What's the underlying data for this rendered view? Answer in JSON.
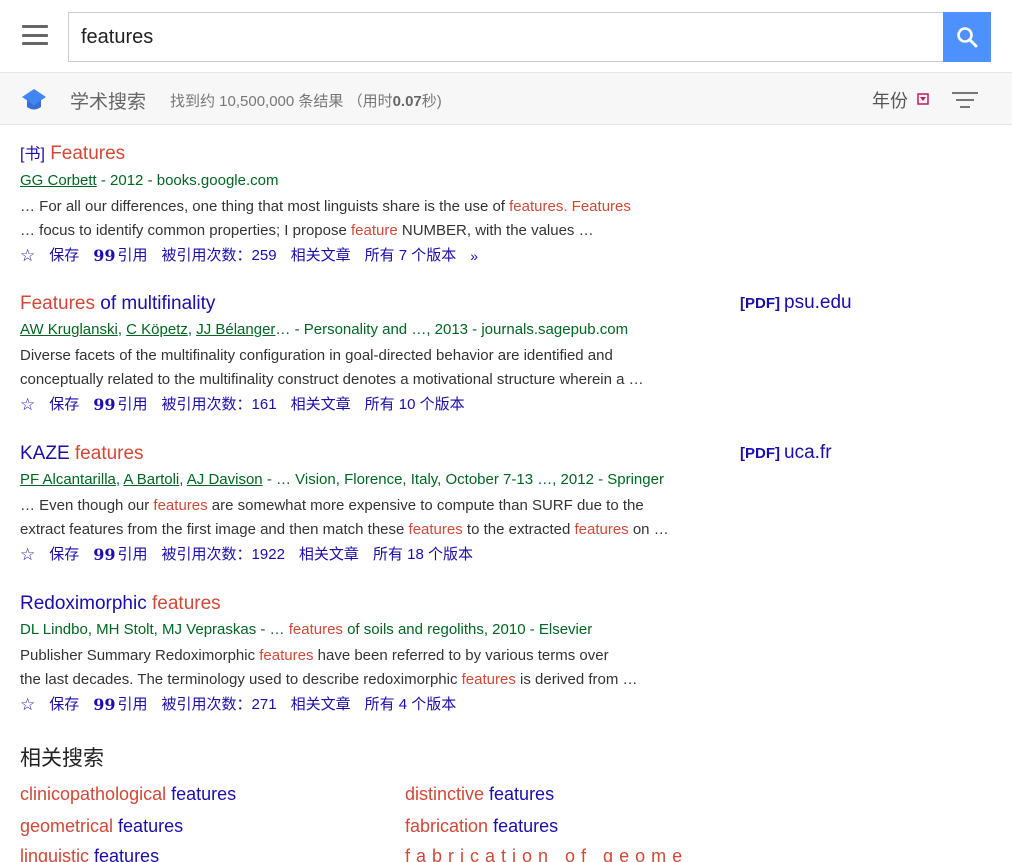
{
  "search": {
    "query": "features"
  },
  "subbar": {
    "scholar_label": "学术搜索",
    "stats_prefix": "找到约 10,500,000 条结果 （用时",
    "stats_time": "0.07",
    "stats_suffix": "秒)",
    "year_label": "年份"
  },
  "actions": {
    "save": "保存",
    "cite": "引用",
    "related": "相关文章"
  },
  "results": [
    {
      "tag": "[书]",
      "title_hl": "Features",
      "title_rest": "",
      "authors": [
        "GG Corbett"
      ],
      "source": " - 2012 - books.google.com",
      "snippet": [
        {
          "t": "… For all our differences, one thing that most linguists share is the use of ",
          "h": false
        },
        {
          "t": "features. Features",
          "h": true
        }
      ],
      "cited": "被引用次数：259",
      "versions": "所有 7 个版本"
    },
    {
      "tag": "",
      "title_hl": "Features",
      "title_rest": " of multifinality",
      "authors": [
        "AW Kruglanski",
        "C Köpetz",
        "JJ Bélanger"
      ],
      "source": "… - Personality and …, 2013 - journals.sagepub.com",
      "snippet": [
        {
          "t": "Diverse facets of the multifinality configuration in goal-directed behavior are identified and",
          "h": false
        }
      ],
      "cited": "被引用次数：161",
      "versions": "所有 10 个版本",
      "pdf_label": "[PDF]",
      "pdf_domain": "psu.edu"
    },
    {
      "tag": "",
      "title_hl": "features",
      "title_rest": "KAZE ",
      "authors": [
        "PF Alcantarilla",
        "A Bartoli",
        "AJ Davison"
      ],
      "source": " - … Vision, Florence, Italy, October 7-13 …, 2012 - Springer",
      "snippet": [
        {
          "t": "… Even though our ",
          "h": false
        },
        {
          "t": "features",
          "h": true
        },
        {
          "t": " are somewhat more expensive to compute than SURF due to the",
          "h": false
        }
      ],
      "snippet2": [
        {
          "t": "extract features from the first image and then match these ",
          "h": false
        },
        {
          "t": "features",
          "h": true
        },
        {
          "t": " to the extracted ",
          "h": false
        },
        {
          "t": "features",
          "h": true
        },
        {
          "t": " on …",
          "h": false
        }
      ],
      "cited": "被引用次数：1922",
      "versions": "所有 18 个版本",
      "pdf_label": "[PDF]",
      "pdf_domain": "uca.fr"
    },
    {
      "tag": "",
      "title_hl": "features",
      "title_rest": "Redoximorphic ",
      "authors": [],
      "source": "DL Lindbo, MH Stolt, MJ Vepraskas - … ",
      "source_hl": "features",
      "source_rest": " of soils and regoliths, 2010 - Elsevier",
      "snippet": [
        {
          "t": "Publisher Summary Redoximorphic ",
          "h": false
        },
        {
          "t": "features",
          "h": true
        },
        {
          "t": " have been referred to by various terms over",
          "h": false
        }
      ],
      "snippet2": [
        {
          "t": "the last decades. The terminology used to describe redoximorphic ",
          "h": false
        },
        {
          "t": "features",
          "h": true
        },
        {
          "t": " is derived from …",
          "h": false
        }
      ],
      "cited": "被引用次数：271",
      "versions": "所有 4 个版本"
    }
  ],
  "r1_snippet2_a": "… focus to identify common properties; I propose ",
  "r1_snippet2_hl": "feature",
  "r1_snippet2_b": " NUMBER, with the values …",
  "r2_snippet2_a": "conceptually related to the multifinality construct denotes a motivational structure wherein a …",
  "related": {
    "title": "相关搜索",
    "items": [
      {
        "hl": "clinicopathological",
        "rest": " features"
      },
      {
        "hl": "geometrical",
        "rest": " features"
      },
      {
        "hl": "linguistic",
        "rest": " features"
      },
      {
        "hl": "distinctive",
        "rest": " features"
      },
      {
        "hl": "fabrication",
        "rest": " features"
      },
      {
        "hl": "fabrication of geome",
        "rest": ""
      }
    ]
  }
}
